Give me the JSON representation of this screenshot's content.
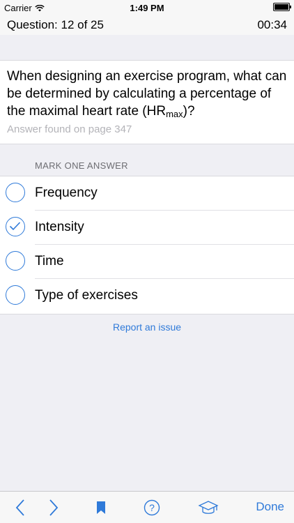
{
  "status_bar": {
    "carrier": "Carrier",
    "time": "1:49 PM"
  },
  "header": {
    "question_progress": "Question: 12 of 25",
    "timer": "00:34"
  },
  "question": {
    "text": "When designing an exercise program, what can be determined by calculating a percentage of the maximal heart rate (HR",
    "subscript": "max",
    "suffix": ")?",
    "answer_page": "Answer found on page 347"
  },
  "answers": {
    "header": "MARK ONE ANSWER",
    "options": [
      {
        "label": "Frequency",
        "selected": false
      },
      {
        "label": "Intensity",
        "selected": true
      },
      {
        "label": "Time",
        "selected": false
      },
      {
        "label": "Type of exercises",
        "selected": false
      }
    ]
  },
  "report_link": "Report an issue",
  "toolbar": {
    "back_icon": "chevron-left-icon",
    "forward_icon": "chevron-right-icon",
    "bookmark_icon": "bookmark-icon",
    "help_icon": "help-icon",
    "study_icon": "graduation-cap-icon",
    "done_label": "Done"
  },
  "colors": {
    "accent": "#2f7ad9",
    "background": "#efeff4",
    "secondary_text": "#b3b3b8"
  }
}
